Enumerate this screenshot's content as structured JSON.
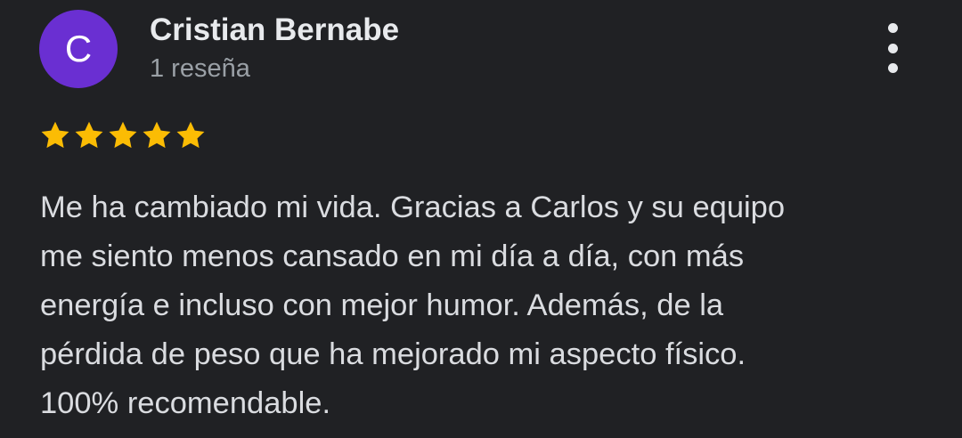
{
  "reviewer": {
    "initial": "C",
    "name": "Cristian Bernabe",
    "meta": "1 reseña",
    "avatar_color": "#6a2fd2"
  },
  "menu": {
    "icon": "more-vert-icon"
  },
  "rating": {
    "stars": 5,
    "max": 5,
    "star_color": "#fbbc04",
    "icon": "star-icon"
  },
  "review": {
    "lines": [
      "Me ha cambiado mi vida. Gracias a Carlos y su equipo",
      "me siento menos cansado en mi día a día, con más",
      "energía e incluso con mejor humor. Además, de la",
      "pérdida de peso que ha mejorado mi aspecto físico.",
      "100% recomendable."
    ]
  }
}
